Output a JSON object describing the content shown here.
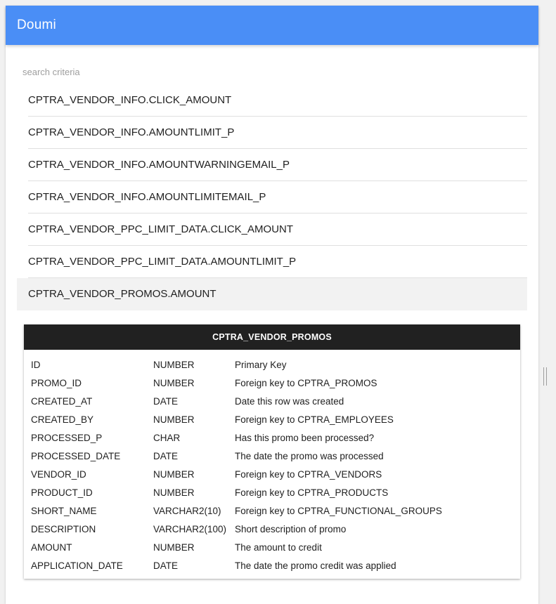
{
  "app": {
    "title": "Doumi"
  },
  "search": {
    "placeholder": "search criteria",
    "value": ""
  },
  "results": [
    {
      "label": "CPTRA_VENDOR_INFO.CLICK_AMOUNT",
      "selected": false
    },
    {
      "label": "CPTRA_VENDOR_INFO.AMOUNTLIMIT_P",
      "selected": false
    },
    {
      "label": "CPTRA_VENDOR_INFO.AMOUNTWARNINGEMAIL_P",
      "selected": false
    },
    {
      "label": "CPTRA_VENDOR_INFO.AMOUNTLIMITEMAIL_P",
      "selected": false
    },
    {
      "label": "CPTRA_VENDOR_PPC_LIMIT_DATA.CLICK_AMOUNT",
      "selected": false
    },
    {
      "label": "CPTRA_VENDOR_PPC_LIMIT_DATA.AMOUNTLIMIT_P",
      "selected": false
    },
    {
      "label": "CPTRA_VENDOR_PROMOS.AMOUNT",
      "selected": true
    }
  ],
  "table": {
    "name": "CPTRA_VENDOR_PROMOS",
    "columns": [
      {
        "name": "ID",
        "type": "NUMBER",
        "description": "Primary Key"
      },
      {
        "name": "PROMO_ID",
        "type": "NUMBER",
        "description": "Foreign key to CPTRA_PROMOS"
      },
      {
        "name": "CREATED_AT",
        "type": "DATE",
        "description": "Date this row was created"
      },
      {
        "name": "CREATED_BY",
        "type": "NUMBER",
        "description": "Foreign key to CPTRA_EMPLOYEES"
      },
      {
        "name": "PROCESSED_P",
        "type": "CHAR",
        "description": "Has this promo been processed?"
      },
      {
        "name": "PROCESSED_DATE",
        "type": "DATE",
        "description": "The date the promo was processed"
      },
      {
        "name": "VENDOR_ID",
        "type": "NUMBER",
        "description": "Foreign key to CPTRA_VENDORS"
      },
      {
        "name": "PRODUCT_ID",
        "type": "NUMBER",
        "description": "Foreign key to CPTRA_PRODUCTS"
      },
      {
        "name": "SHORT_NAME",
        "type": "VARCHAR2(10)",
        "description": "Foreign key to CPTRA_FUNCTIONAL_GROUPS"
      },
      {
        "name": "DESCRIPTION",
        "type": "VARCHAR2(100)",
        "description": "Short description of promo"
      },
      {
        "name": "AMOUNT",
        "type": "NUMBER",
        "description": "The amount to credit"
      },
      {
        "name": "APPLICATION_DATE",
        "type": "DATE",
        "description": "The date the promo credit was applied"
      }
    ]
  },
  "colors": {
    "app_bar": "#4a8ef6",
    "table_header": "#212121",
    "selected_row": "#f2f2f2",
    "page_background": "#f1f1f1"
  },
  "icons": {
    "splitter": "resize-handle-icon"
  }
}
